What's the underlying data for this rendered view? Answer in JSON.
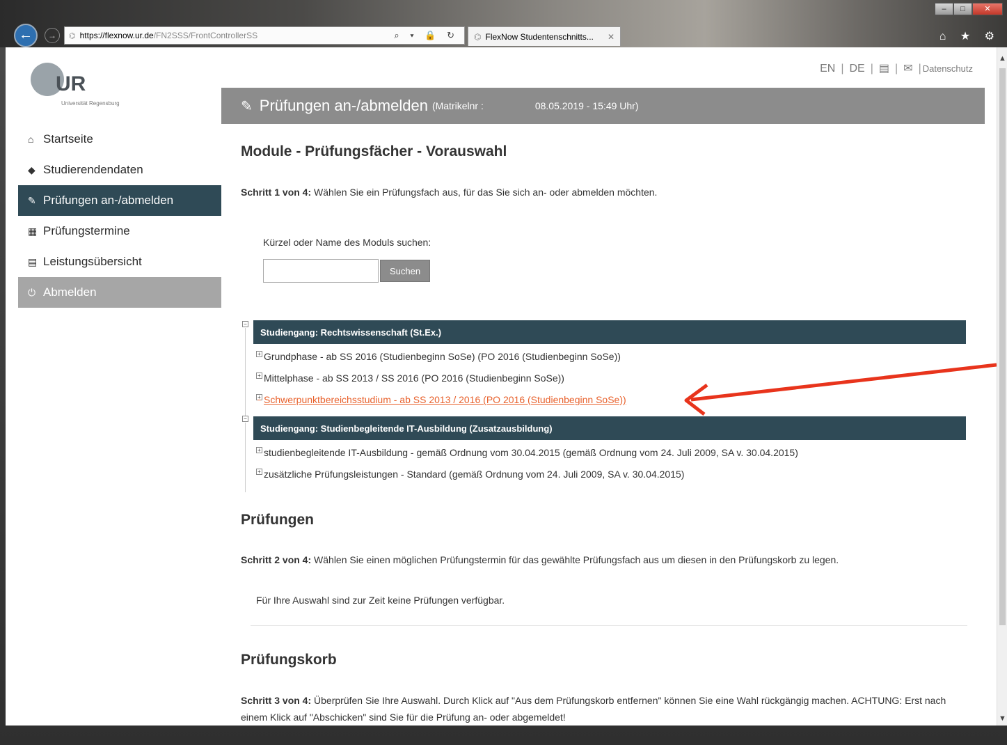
{
  "browser": {
    "url_host": "https://flexnow.ur.de",
    "url_path": "/FN2SSS/FrontControllerSS",
    "tab_title": "FlexNow Studentenschnitts...",
    "addr_icons": "⌕ ▾ 🔒 ↻",
    "toolbar_icons": "⌂ ★ ⚙"
  },
  "logo": {
    "letters": "UR",
    "subtitle": "Universität Regensburg"
  },
  "toplinks": {
    "en": "EN",
    "de": "DE",
    "privacy": "Datenschutz"
  },
  "sidebar": {
    "items": [
      {
        "label": "Startseite",
        "icon": "home-icon"
      },
      {
        "label": "Studierendendaten",
        "icon": "graduation-cap-icon"
      },
      {
        "label": "Prüfungen an-/abmelden",
        "icon": "edit-icon"
      },
      {
        "label": "Prüfungstermine",
        "icon": "calendar-icon"
      },
      {
        "label": "Leistungsübersicht",
        "icon": "list-icon"
      },
      {
        "label": "Abmelden",
        "icon": "power-icon"
      }
    ]
  },
  "header": {
    "title": "Prüfungen an-/abmelden",
    "matrikel": "(Matrikelnr :",
    "datetime": "08.05.2019 - 15:49 Uhr)"
  },
  "section1": {
    "title": "Module - Prüfungsfächer - Vorauswahl",
    "step_bold": "Schritt 1 von 4:",
    "step_text": " Wählen Sie ein Prüfungsfach aus, für das Sie sich an- oder abmelden möchten.",
    "search_label": "Kürzel oder Name des Moduls suchen:",
    "search_value": "",
    "search_button": "Suchen"
  },
  "tree": {
    "group1": {
      "label": "Studiengang: Rechtswissenschaft (St.Ex.)",
      "items": [
        "Grundphase - ab SS 2016 (Studienbeginn SoSe) (PO 2016 (Studienbeginn SoSe))",
        "Mittelphase - ab SS 2013 / SS 2016 (PO 2016 (Studienbeginn SoSe))",
        "Schwerpunktbereichsstudium - ab SS 2013 / 2016 (PO 2016 (Studienbeginn SoSe))"
      ]
    },
    "group2": {
      "label": "Studiengang: Studienbegleitende IT-Ausbildung (Zusatzausbildung)",
      "items": [
        "studienbegleitende IT-Ausbildung - gemäß Ordnung vom 30.04.2015 (gemäß Ordnung vom 24. Juli 2009, SA v. 30.04.2015)",
        "zusätzliche Prüfungsleistungen - Standard (gemäß Ordnung vom 24. Juli 2009, SA v. 30.04.2015)"
      ]
    },
    "highlight_color": "#e8612c",
    "arrow_color": "#e8341c"
  },
  "section2": {
    "title": "Prüfungen",
    "step_bold": "Schritt 2 von 4:",
    "step_text": " Wählen Sie einen möglichen Prüfungstermin für das gewählte Prüfungsfach aus um diesen in den Prüfungskorb zu legen.",
    "no_exam": "Für Ihre Auswahl sind zur Zeit keine Prüfungen verfügbar."
  },
  "section3": {
    "title": "Prüfungskorb",
    "step_bold": "Schritt 3 von 4:",
    "step_text": " Überprüfen Sie Ihre Auswahl. Durch Klick auf \"Aus dem Prüfungskorb entfernen\" können Sie eine Wahl rückgängig machen. ACHTUNG: Erst nach einem Klick auf \"Abschicken\" sind Sie für die Prüfung an- oder abgemeldet!"
  }
}
